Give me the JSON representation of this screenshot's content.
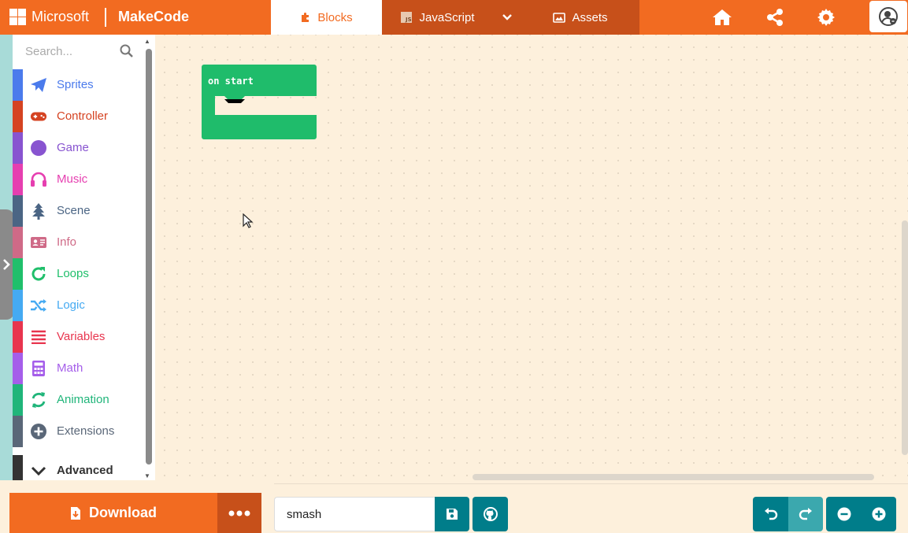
{
  "header": {
    "brand_microsoft": "Microsoft",
    "brand_makecode": "MakeCode",
    "tabs": [
      {
        "label": "Blocks",
        "icon": "puzzle-icon",
        "active": true
      },
      {
        "label": "JavaScript",
        "icon": "js-icon",
        "active": false
      },
      {
        "label": "Assets",
        "icon": "image-icon",
        "active": false
      }
    ],
    "icons": [
      "home-icon",
      "share-icon",
      "gear-icon",
      "profile-icon"
    ],
    "colors": {
      "primary": "#f26b21",
      "tab_bar": "#c7501a"
    }
  },
  "toolbox": {
    "search_placeholder": "Search...",
    "categories": [
      {
        "label": "Sprites",
        "color": "#4b7bec",
        "icon": "paper-plane-icon"
      },
      {
        "label": "Controller",
        "color": "#d54322",
        "icon": "gamepad-icon"
      },
      {
        "label": "Game",
        "color": "#8854d0",
        "icon": "circle-icon"
      },
      {
        "label": "Music",
        "color": "#e63fb0",
        "icon": "headphones-icon"
      },
      {
        "label": "Scene",
        "color": "#4b6584",
        "icon": "tree-icon"
      },
      {
        "label": "Info",
        "color": "#cf6a87",
        "icon": "id-card-icon"
      },
      {
        "label": "Loops",
        "color": "#20bf6b",
        "icon": "refresh-icon"
      },
      {
        "label": "Logic",
        "color": "#45aaf2",
        "icon": "shuffle-icon"
      },
      {
        "label": "Variables",
        "color": "#e8354e",
        "icon": "list-icon"
      },
      {
        "label": "Math",
        "color": "#a55eea",
        "icon": "calculator-icon"
      },
      {
        "label": "Animation",
        "color": "#20b57a",
        "icon": "rotate-icon"
      },
      {
        "label": "Extensions",
        "color": "#5a6778",
        "icon": "plus-circle-icon"
      },
      {
        "label": "Advanced",
        "color": "#333333",
        "icon": "chevron-down-icon"
      }
    ]
  },
  "workspace": {
    "block_label": "on start",
    "block_color": "#1fbc6b"
  },
  "bottom": {
    "download_label": "Download",
    "project_name": "smash",
    "button_color": "#007d8a"
  }
}
